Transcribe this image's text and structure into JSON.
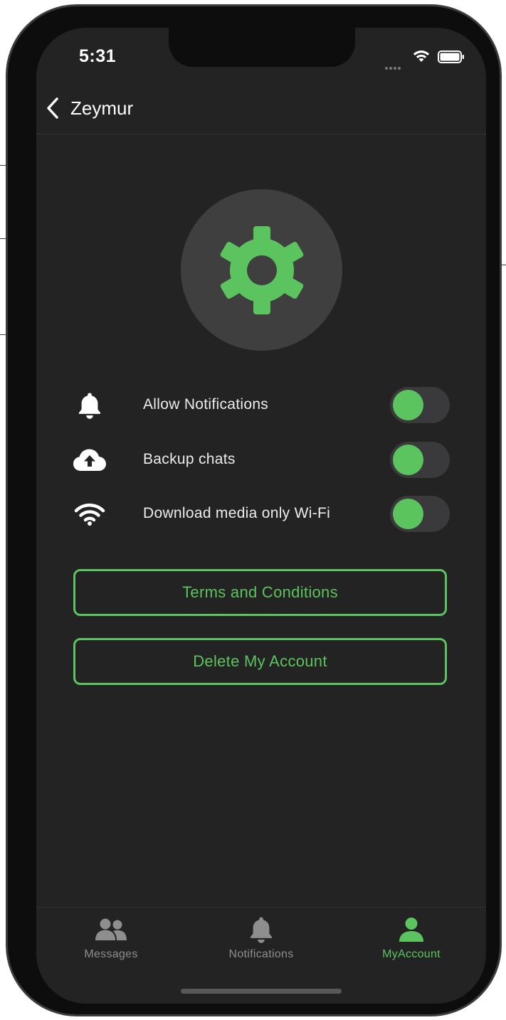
{
  "status_bar": {
    "time": "5:31"
  },
  "nav": {
    "back_title": "Zeymur"
  },
  "settings": {
    "rows": [
      {
        "label": "Allow Notifications",
        "icon": "bell-icon",
        "enabled": true
      },
      {
        "label": "Backup chats",
        "icon": "cloud-upload-icon",
        "enabled": true
      },
      {
        "label": "Download media only Wi-Fi",
        "icon": "wifi-icon",
        "enabled": true
      }
    ]
  },
  "buttons": {
    "terms": "Terms and Conditions",
    "delete_account": "Delete My Account"
  },
  "tab_bar": {
    "tabs": [
      {
        "label": "Messages",
        "icon": "users-icon",
        "active": false
      },
      {
        "label": "Notifications",
        "icon": "bell-icon",
        "active": false
      },
      {
        "label": "MyAccount",
        "icon": "user-icon",
        "active": true
      }
    ]
  },
  "colors": {
    "accent": "#5cc45e",
    "background": "#232323",
    "toggle_track": "#3a3a3c",
    "inactive_tab": "#8e8e8e"
  }
}
